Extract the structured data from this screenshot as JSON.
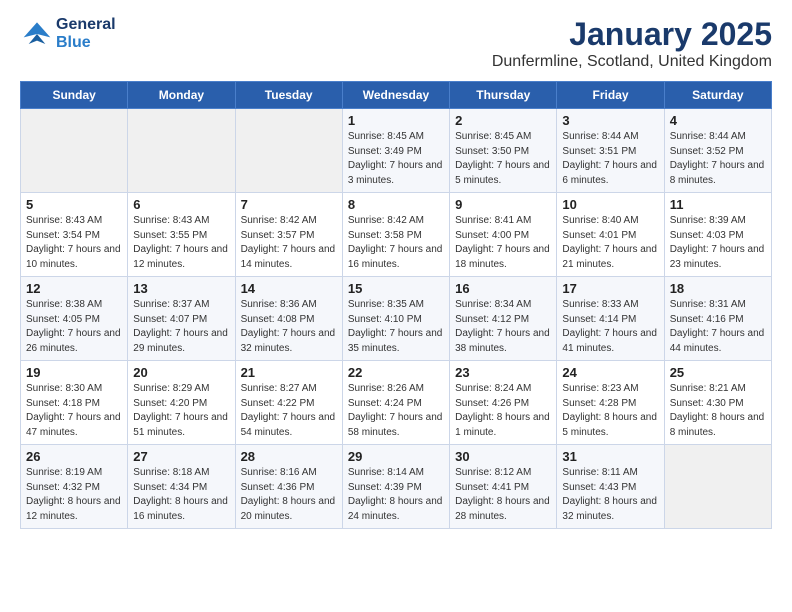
{
  "header": {
    "logo_line1": "General",
    "logo_line2": "Blue",
    "title": "January 2025",
    "subtitle": "Dunfermline, Scotland, United Kingdom"
  },
  "days_of_week": [
    "Sunday",
    "Monday",
    "Tuesday",
    "Wednesday",
    "Thursday",
    "Friday",
    "Saturday"
  ],
  "weeks": [
    [
      {
        "num": "",
        "info": ""
      },
      {
        "num": "",
        "info": ""
      },
      {
        "num": "",
        "info": ""
      },
      {
        "num": "1",
        "info": "Sunrise: 8:45 AM\nSunset: 3:49 PM\nDaylight: 7 hours\nand 3 minutes."
      },
      {
        "num": "2",
        "info": "Sunrise: 8:45 AM\nSunset: 3:50 PM\nDaylight: 7 hours\nand 5 minutes."
      },
      {
        "num": "3",
        "info": "Sunrise: 8:44 AM\nSunset: 3:51 PM\nDaylight: 7 hours\nand 6 minutes."
      },
      {
        "num": "4",
        "info": "Sunrise: 8:44 AM\nSunset: 3:52 PM\nDaylight: 7 hours\nand 8 minutes."
      }
    ],
    [
      {
        "num": "5",
        "info": "Sunrise: 8:43 AM\nSunset: 3:54 PM\nDaylight: 7 hours\nand 10 minutes."
      },
      {
        "num": "6",
        "info": "Sunrise: 8:43 AM\nSunset: 3:55 PM\nDaylight: 7 hours\nand 12 minutes."
      },
      {
        "num": "7",
        "info": "Sunrise: 8:42 AM\nSunset: 3:57 PM\nDaylight: 7 hours\nand 14 minutes."
      },
      {
        "num": "8",
        "info": "Sunrise: 8:42 AM\nSunset: 3:58 PM\nDaylight: 7 hours\nand 16 minutes."
      },
      {
        "num": "9",
        "info": "Sunrise: 8:41 AM\nSunset: 4:00 PM\nDaylight: 7 hours\nand 18 minutes."
      },
      {
        "num": "10",
        "info": "Sunrise: 8:40 AM\nSunset: 4:01 PM\nDaylight: 7 hours\nand 21 minutes."
      },
      {
        "num": "11",
        "info": "Sunrise: 8:39 AM\nSunset: 4:03 PM\nDaylight: 7 hours\nand 23 minutes."
      }
    ],
    [
      {
        "num": "12",
        "info": "Sunrise: 8:38 AM\nSunset: 4:05 PM\nDaylight: 7 hours\nand 26 minutes."
      },
      {
        "num": "13",
        "info": "Sunrise: 8:37 AM\nSunset: 4:07 PM\nDaylight: 7 hours\nand 29 minutes."
      },
      {
        "num": "14",
        "info": "Sunrise: 8:36 AM\nSunset: 4:08 PM\nDaylight: 7 hours\nand 32 minutes."
      },
      {
        "num": "15",
        "info": "Sunrise: 8:35 AM\nSunset: 4:10 PM\nDaylight: 7 hours\nand 35 minutes."
      },
      {
        "num": "16",
        "info": "Sunrise: 8:34 AM\nSunset: 4:12 PM\nDaylight: 7 hours\nand 38 minutes."
      },
      {
        "num": "17",
        "info": "Sunrise: 8:33 AM\nSunset: 4:14 PM\nDaylight: 7 hours\nand 41 minutes."
      },
      {
        "num": "18",
        "info": "Sunrise: 8:31 AM\nSunset: 4:16 PM\nDaylight: 7 hours\nand 44 minutes."
      }
    ],
    [
      {
        "num": "19",
        "info": "Sunrise: 8:30 AM\nSunset: 4:18 PM\nDaylight: 7 hours\nand 47 minutes."
      },
      {
        "num": "20",
        "info": "Sunrise: 8:29 AM\nSunset: 4:20 PM\nDaylight: 7 hours\nand 51 minutes."
      },
      {
        "num": "21",
        "info": "Sunrise: 8:27 AM\nSunset: 4:22 PM\nDaylight: 7 hours\nand 54 minutes."
      },
      {
        "num": "22",
        "info": "Sunrise: 8:26 AM\nSunset: 4:24 PM\nDaylight: 7 hours\nand 58 minutes."
      },
      {
        "num": "23",
        "info": "Sunrise: 8:24 AM\nSunset: 4:26 PM\nDaylight: 8 hours\nand 1 minute."
      },
      {
        "num": "24",
        "info": "Sunrise: 8:23 AM\nSunset: 4:28 PM\nDaylight: 8 hours\nand 5 minutes."
      },
      {
        "num": "25",
        "info": "Sunrise: 8:21 AM\nSunset: 4:30 PM\nDaylight: 8 hours\nand 8 minutes."
      }
    ],
    [
      {
        "num": "26",
        "info": "Sunrise: 8:19 AM\nSunset: 4:32 PM\nDaylight: 8 hours\nand 12 minutes."
      },
      {
        "num": "27",
        "info": "Sunrise: 8:18 AM\nSunset: 4:34 PM\nDaylight: 8 hours\nand 16 minutes."
      },
      {
        "num": "28",
        "info": "Sunrise: 8:16 AM\nSunset: 4:36 PM\nDaylight: 8 hours\nand 20 minutes."
      },
      {
        "num": "29",
        "info": "Sunrise: 8:14 AM\nSunset: 4:39 PM\nDaylight: 8 hours\nand 24 minutes."
      },
      {
        "num": "30",
        "info": "Sunrise: 8:12 AM\nSunset: 4:41 PM\nDaylight: 8 hours\nand 28 minutes."
      },
      {
        "num": "31",
        "info": "Sunrise: 8:11 AM\nSunset: 4:43 PM\nDaylight: 8 hours\nand 32 minutes."
      },
      {
        "num": "",
        "info": ""
      }
    ]
  ]
}
